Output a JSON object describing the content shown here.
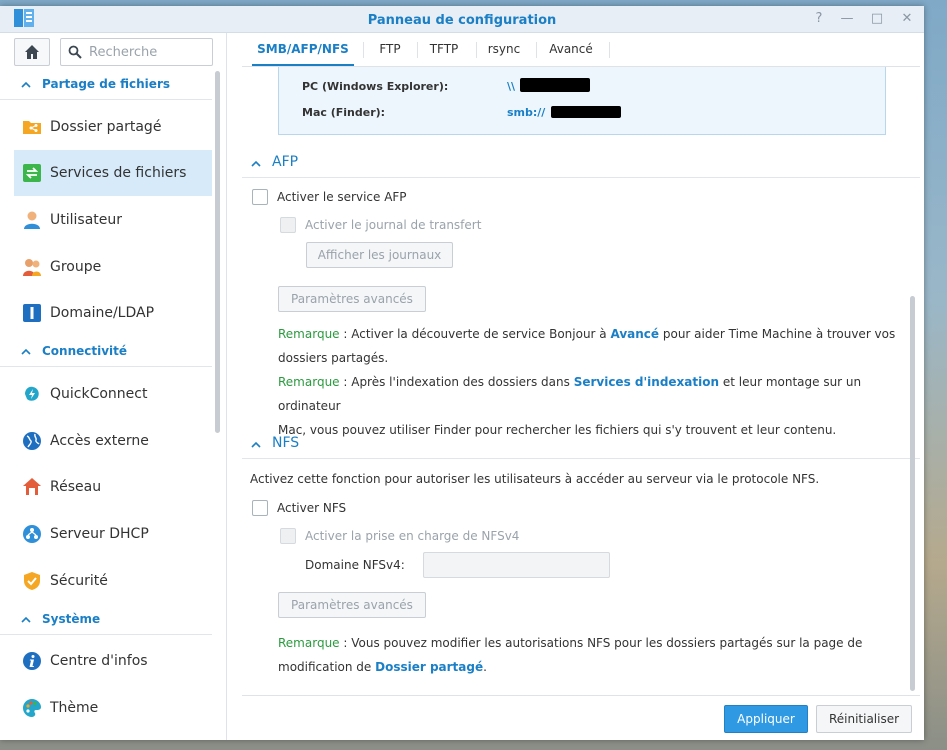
{
  "window": {
    "title": "Panneau de configuration",
    "controls": [
      "help-icon",
      "minimize-icon",
      "maximize-icon",
      "close-icon"
    ],
    "control_glyphs": {
      "help": "?",
      "minimize": "—",
      "maximize": "□",
      "close": "✕"
    }
  },
  "sidebar": {
    "search_placeholder": "Recherche",
    "sections": [
      {
        "label": "Partage de fichiers"
      },
      {
        "label": "Connectivité"
      },
      {
        "label": "Système"
      }
    ],
    "items": [
      {
        "label": "Dossier partagé",
        "icon": "shared-folder-icon",
        "active": false
      },
      {
        "label": "Services de fichiers",
        "icon": "file-services-icon",
        "active": true
      },
      {
        "label": "Utilisateur",
        "icon": "user-icon",
        "active": false
      },
      {
        "label": "Groupe",
        "icon": "group-icon",
        "active": false
      },
      {
        "label": "Domaine/LDAP",
        "icon": "domain-ldap-icon",
        "active": false
      },
      {
        "label": "QuickConnect",
        "icon": "quickconnect-icon",
        "active": false
      },
      {
        "label": "Accès externe",
        "icon": "globe-icon",
        "active": false
      },
      {
        "label": "Réseau",
        "icon": "network-icon",
        "active": false
      },
      {
        "label": "Serveur DHCP",
        "icon": "dhcp-server-icon",
        "active": false
      },
      {
        "label": "Sécurité",
        "icon": "shield-icon",
        "active": false
      },
      {
        "label": "Centre d'infos",
        "icon": "info-icon",
        "active": false
      },
      {
        "label": "Thème",
        "icon": "palette-icon",
        "active": false
      }
    ]
  },
  "tabs": [
    {
      "label": "SMB/AFP/NFS",
      "active": true
    },
    {
      "label": "FTP",
      "active": false
    },
    {
      "label": "TFTP",
      "active": false
    },
    {
      "label": "rsync",
      "active": false
    },
    {
      "label": "Avancé",
      "active": false
    }
  ],
  "smb_info": {
    "pc_label": "PC (Windows Explorer):",
    "pc_value": "\\\\",
    "mac_label": "Mac (Finder):",
    "mac_value": "smb://"
  },
  "afp": {
    "title": "AFP",
    "enable_label": "Activer le service AFP",
    "enable_checked": false,
    "journal_label": "Activer le journal de transfert",
    "journal_checked": false,
    "show_logs_button": "Afficher les journaux",
    "advanced_button": "Paramètres avancés",
    "note1": {
      "prefix": "Remarque",
      "text1": " : Activer la découverte de service Bonjour à ",
      "link": "Avancé",
      "text2": " pour aider Time Machine à trouver vos",
      "text3": "dossiers partagés."
    },
    "note2": {
      "prefix": "Remarque",
      "text1": " : Après l'indexation des dossiers dans ",
      "link": "Services d'indexation",
      "text2": " et leur montage sur un ordinateur",
      "text3": "Mac, vous pouvez utiliser Finder pour rechercher les fichiers qui s'y trouvent et leur contenu."
    }
  },
  "nfs": {
    "title": "NFS",
    "description": "Activez cette fonction pour autoriser les utilisateurs à accéder au serveur via le protocole NFS.",
    "enable_label": "Activer NFS",
    "enable_checked": false,
    "nfsv4_label": "Activer la prise en charge de NFSv4",
    "nfsv4_checked": false,
    "domain_label": "Domaine NFSv4:",
    "domain_value": "",
    "advanced_button": "Paramètres avancés",
    "note": {
      "prefix": "Remarque",
      "text1": " : Vous pouvez modifier les autorisations NFS pour les dossiers partagés sur la page de",
      "text2": "modification de ",
      "link": "Dossier partagé",
      "text3": "."
    }
  },
  "footer": {
    "apply_label": "Appliquer",
    "reset_label": "Réinitialiser"
  },
  "colors": {
    "accent": "#1b7fc6",
    "remark_green": "#2b9a3f",
    "active_nav_bg": "#d6eaf9",
    "apply_blue": "#2f9ae3"
  }
}
